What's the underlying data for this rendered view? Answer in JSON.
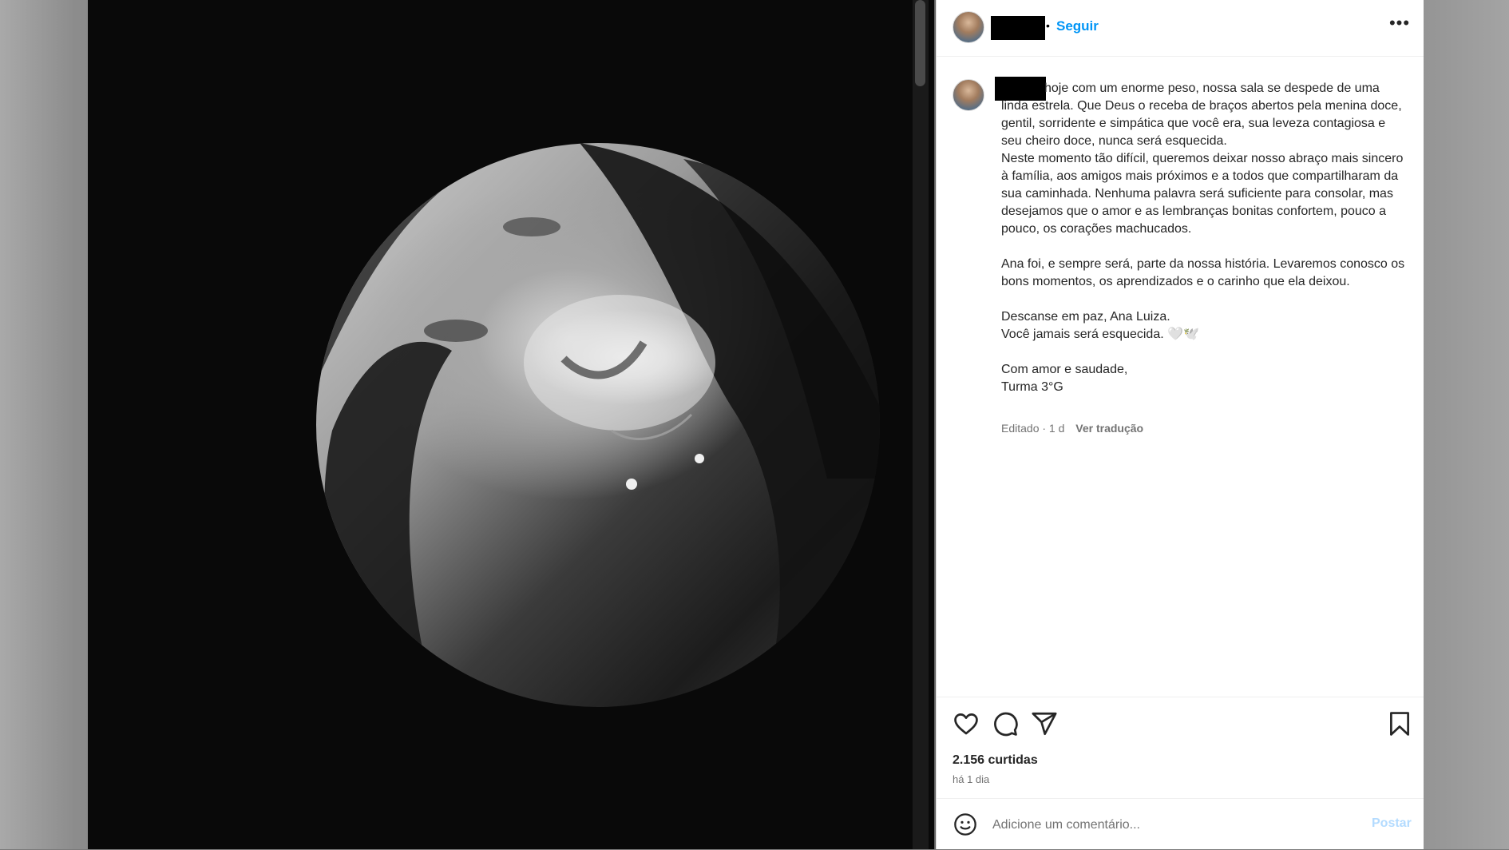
{
  "post": {
    "follow_label": "Seguir",
    "more_icon": "more-horizontal-icon",
    "caption": {
      "p1": "hoje com um enorme peso, nossa sala se despede de uma linda estrela. Que Deus o receba de braços abertos pela menina doce, gentil, sorridente e simpática que você era, sua leveza contagiosa e seu cheiro doce, nunca será esquecida.",
      "p2": "Neste momento tão difícil, queremos deixar nosso abraço mais sincero à família, aos amigos mais próximos e a todos que compartilharam da sua caminhada. Nenhuma palavra será suficiente para consolar, mas desejamos que o amor e as lembranças bonitas confortem, pouco a pouco, os corações machucados.",
      "p3": "Ana foi, e sempre será, parte da nossa história. Levaremos conosco os bons momentos, os aprendizados e o carinho que ela deixou.",
      "p4_line1": "Descanse em paz, Ana Luiza.",
      "p4_line2": "Você jamais será esquecida. 🤍🕊️",
      "p5_line1": "Com amor e saudade,",
      "p5_line2": "Turma 3°G"
    },
    "meta": {
      "edited": "Editado · 1 d",
      "translate": "Ver tradução"
    },
    "actions": {
      "icons": [
        "heart-icon",
        "comment-icon",
        "share-icon",
        "bookmark-icon"
      ]
    },
    "likes": "2.156 curtidas",
    "time": "há 1 dia",
    "comment": {
      "placeholder": "Adicione um comentário...",
      "post_label": "Postar"
    }
  }
}
